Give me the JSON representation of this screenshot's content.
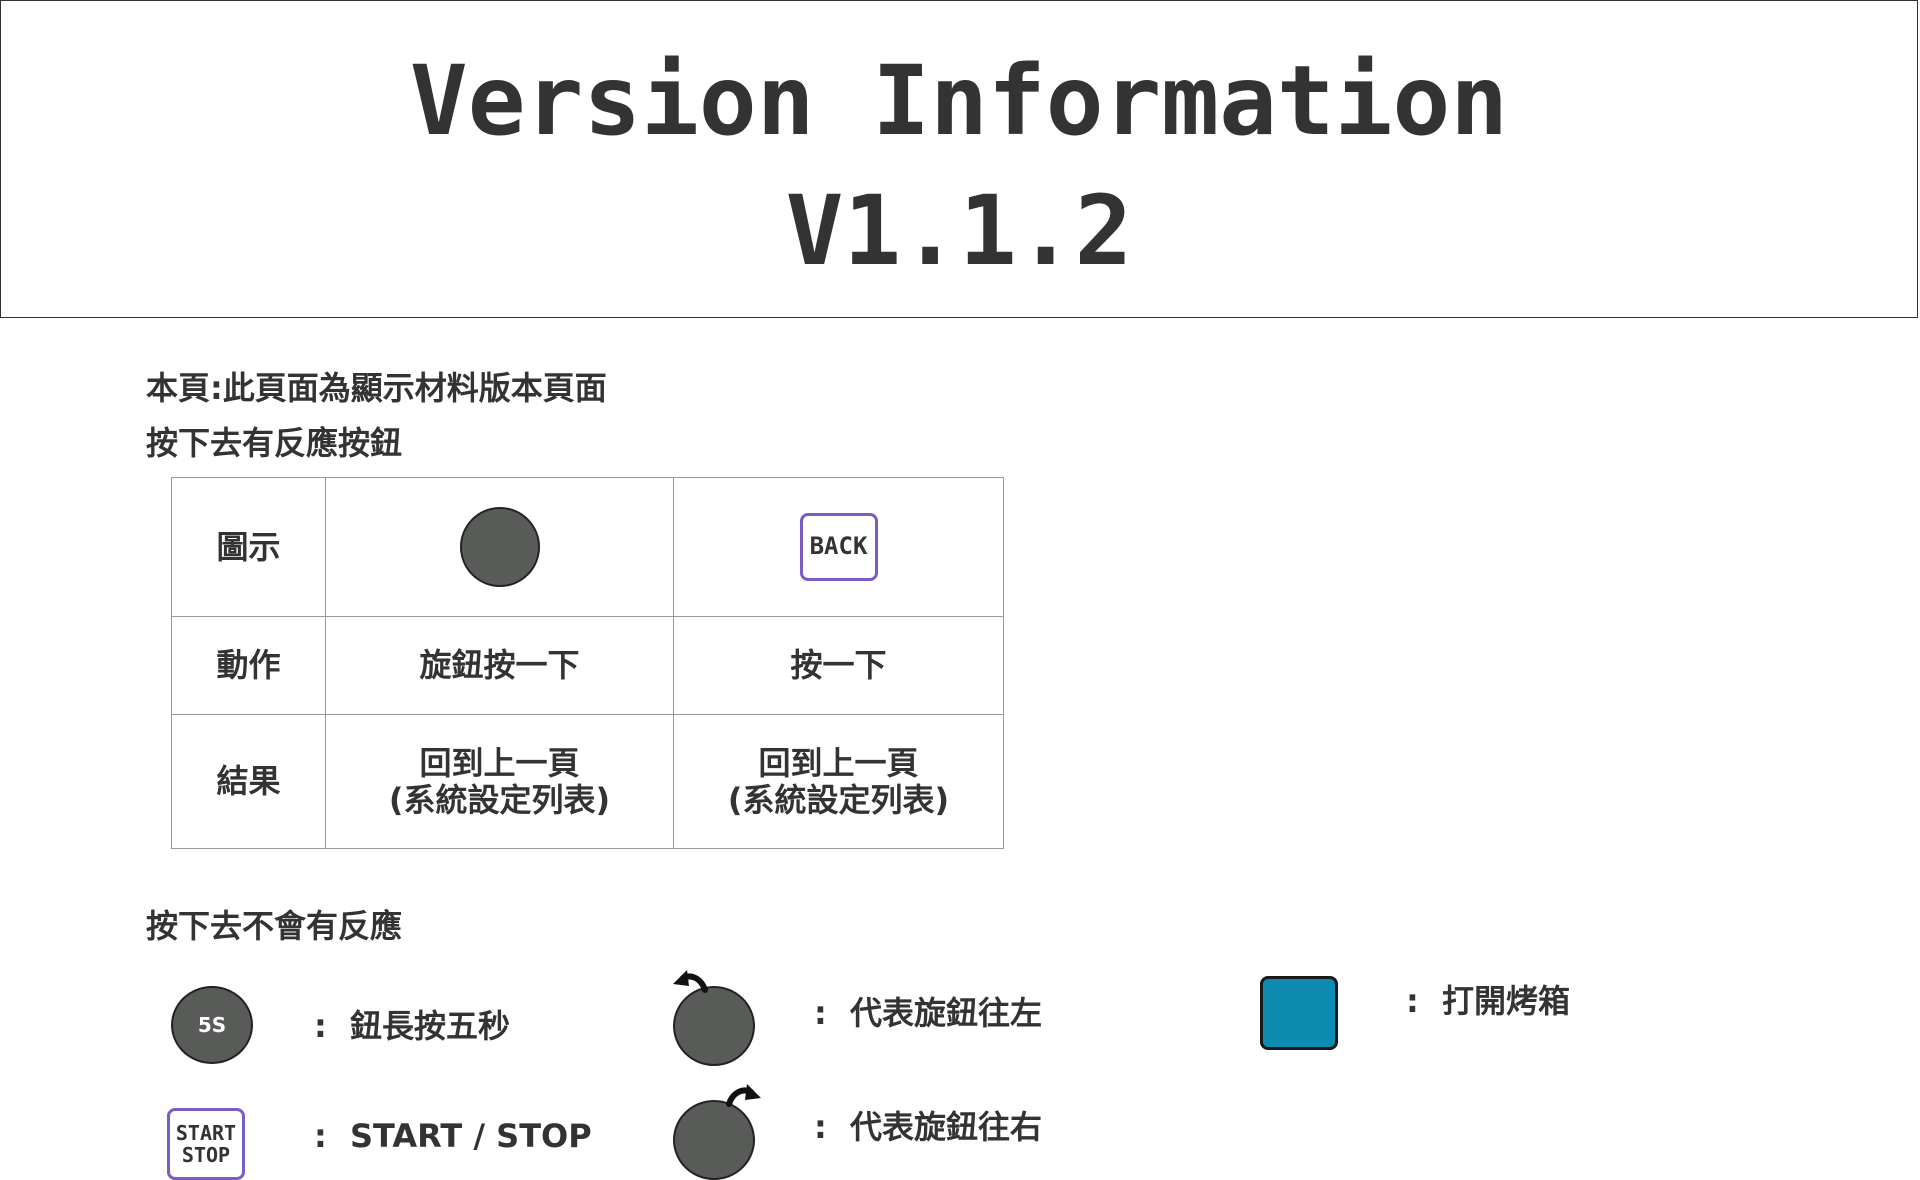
{
  "header": {
    "title": "Version Information",
    "version": "V1.1.2"
  },
  "intro": {
    "page_desc": "本頁:此頁面為顯示材料版本頁面",
    "responsive_heading": "按下去有反應按鈕",
    "unresponsive_heading": "按下去不會有反應"
  },
  "table": {
    "rows": [
      {
        "label": "圖示"
      },
      {
        "label": "動作",
        "col1": "旋鈕按一下",
        "col2": "按一下"
      },
      {
        "label": "結果",
        "col1_line1": "回到上一頁",
        "col1_line2": "(系統設定列表)",
        "col2_line1": "回到上一頁",
        "col2_line2": "(系統設定列表)"
      }
    ],
    "back_button_label": "BACK"
  },
  "legend": {
    "knob_5s": {
      "icon_text": "5S",
      "colon": ":",
      "label": "鈕長按五秒"
    },
    "start_stop": {
      "icon_line1": "START",
      "icon_line2": "STOP",
      "colon": ":",
      "label": "START / STOP"
    },
    "rotate_left": {
      "icon": "knob-rotate-left-icon",
      "colon": ":",
      "label": "代表旋鈕往左"
    },
    "rotate_right": {
      "icon": "knob-rotate-right-icon",
      "colon": ":",
      "label": "代表旋鈕往右"
    },
    "oven": {
      "icon": "oven-button-icon",
      "colon": ":",
      "label": "打開烤箱"
    }
  },
  "colors": {
    "knob": "#595b58",
    "button_border": "#7b5cc4",
    "oven_button": "#0e8bb0",
    "text": "#333333"
  }
}
